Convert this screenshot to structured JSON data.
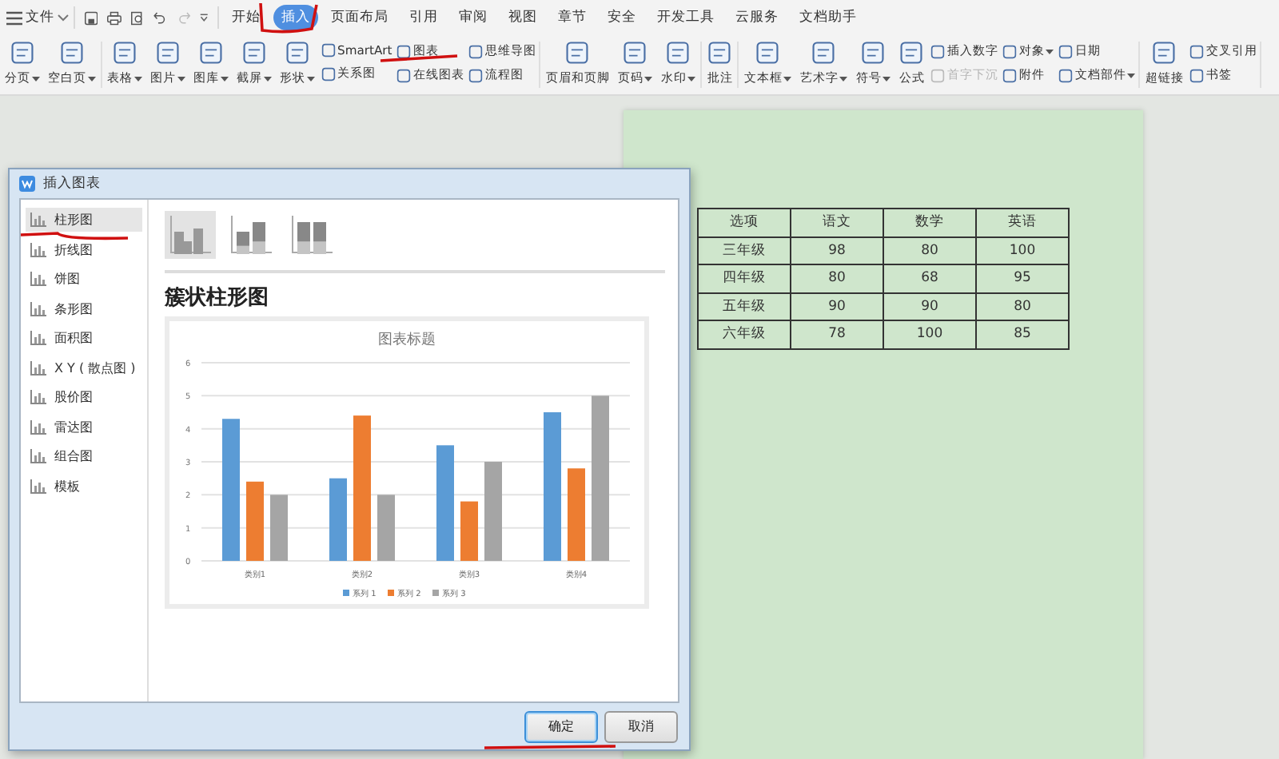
{
  "menu": {
    "label": "文件"
  },
  "tabs": [
    {
      "label": "开始",
      "selected": false
    },
    {
      "label": "插入",
      "selected": true
    },
    {
      "label": "页面布局",
      "selected": false
    },
    {
      "label": "引用",
      "selected": false
    },
    {
      "label": "审阅",
      "selected": false
    },
    {
      "label": "视图",
      "selected": false
    },
    {
      "label": "章节",
      "selected": false
    },
    {
      "label": "安全",
      "selected": false
    },
    {
      "label": "开发工具",
      "selected": false
    },
    {
      "label": "云服务",
      "selected": false
    },
    {
      "label": "文档助手",
      "selected": false
    }
  ],
  "ribbon": {
    "groups": [
      {
        "entries": [
          {
            "kind": "large",
            "label": "分页",
            "dropdown": true
          },
          {
            "kind": "large",
            "label": "空白页",
            "dropdown": true
          }
        ]
      },
      {
        "entries": [
          {
            "kind": "large",
            "label": "表格",
            "dropdown": true
          },
          {
            "kind": "large",
            "label": "图片",
            "dropdown": true
          },
          {
            "kind": "large",
            "label": "图库",
            "dropdown": true
          },
          {
            "kind": "large",
            "label": "截屏",
            "dropdown": true
          },
          {
            "kind": "large",
            "label": "形状",
            "dropdown": true
          },
          {
            "kind": "stack",
            "items": [
              {
                "label": "SmartArt",
                "dropdown": false,
                "disabled": false
              },
              {
                "label": "关系图",
                "dropdown": false,
                "disabled": false
              }
            ]
          },
          {
            "kind": "stack",
            "items": [
              {
                "label": "图表",
                "dropdown": false,
                "disabled": false
              },
              {
                "label": "在线图表",
                "dropdown": false,
                "disabled": false
              }
            ]
          },
          {
            "kind": "stack",
            "items": [
              {
                "label": "思维导图",
                "dropdown": false,
                "disabled": false
              },
              {
                "label": "流程图",
                "dropdown": false,
                "disabled": false
              }
            ]
          }
        ]
      },
      {
        "entries": [
          {
            "kind": "large",
            "label": "页眉和页脚",
            "dropdown": false
          },
          {
            "kind": "large",
            "label": "页码",
            "dropdown": true
          },
          {
            "kind": "large",
            "label": "水印",
            "dropdown": true
          }
        ]
      },
      {
        "entries": [
          {
            "kind": "large",
            "label": "批注",
            "dropdown": false
          }
        ]
      },
      {
        "entries": [
          {
            "kind": "large",
            "label": "文本框",
            "dropdown": true
          },
          {
            "kind": "large",
            "label": "艺术字",
            "dropdown": true
          },
          {
            "kind": "large",
            "label": "符号",
            "dropdown": true
          },
          {
            "kind": "large",
            "label": "公式",
            "dropdown": false
          },
          {
            "kind": "stack",
            "items": [
              {
                "label": "插入数字",
                "dropdown": false,
                "disabled": false
              },
              {
                "label": "首字下沉",
                "dropdown": false,
                "disabled": true
              }
            ]
          },
          {
            "kind": "stack",
            "items": [
              {
                "label": "对象",
                "dropdown": true,
                "disabled": false
              },
              {
                "label": "附件",
                "dropdown": false,
                "disabled": false
              }
            ]
          },
          {
            "kind": "stack",
            "items": [
              {
                "label": "日期",
                "dropdown": false,
                "disabled": false
              },
              {
                "label": "文档部件",
                "dropdown": true,
                "disabled": false
              }
            ]
          }
        ]
      },
      {
        "entries": [
          {
            "kind": "large",
            "label": "超链接",
            "dropdown": false
          },
          {
            "kind": "stack",
            "items": [
              {
                "label": "交叉引用",
                "dropdown": false,
                "disabled": false
              },
              {
                "label": "书签",
                "dropdown": false,
                "disabled": false
              }
            ]
          }
        ]
      }
    ]
  },
  "document": {
    "table": {
      "columns": [
        "选项",
        "语文",
        "数学",
        "英语"
      ],
      "rows": [
        [
          "三年级",
          "98",
          "80",
          "100"
        ],
        [
          "四年级",
          "80",
          "68",
          "95"
        ],
        [
          "五年级",
          "90",
          "90",
          "80"
        ],
        [
          "六年级",
          "78",
          "100",
          "85"
        ]
      ]
    }
  },
  "dialog": {
    "title": "插入图表",
    "types": [
      {
        "label": "柱形图",
        "selected": true
      },
      {
        "label": "折线图",
        "selected": false
      },
      {
        "label": "饼图",
        "selected": false
      },
      {
        "label": "条形图",
        "selected": false
      },
      {
        "label": "面积图",
        "selected": false
      },
      {
        "label": "X Y ( 散点图 )",
        "selected": false
      },
      {
        "label": "股价图",
        "selected": false
      },
      {
        "label": "雷达图",
        "selected": false
      },
      {
        "label": "组合图",
        "selected": false
      },
      {
        "label": "模板",
        "selected": false
      }
    ],
    "subtypes": [
      {
        "kind": "clustered",
        "selected": true
      },
      {
        "kind": "stacked",
        "selected": false
      },
      {
        "kind": "percent",
        "selected": false
      }
    ],
    "subtype_title": "簇状柱形图",
    "preview": {
      "chart_data": {
        "type": "bar",
        "title": "图表标题",
        "categories": [
          "类别1",
          "类别2",
          "类别3",
          "类别4"
        ],
        "series": [
          {
            "name": "系列 1",
            "color": "#5b9bd5",
            "values": [
              4.3,
              2.5,
              3.5,
              4.5
            ]
          },
          {
            "name": "系列 2",
            "color": "#ed7d31",
            "values": [
              2.4,
              4.4,
              1.8,
              2.8
            ]
          },
          {
            "name": "系列 3",
            "color": "#a5a5a5",
            "values": [
              2,
              2,
              3,
              5
            ]
          }
        ],
        "ylim": [
          0,
          6
        ],
        "yticks": [
          0,
          1,
          2,
          3,
          4,
          5,
          6
        ],
        "grid": true,
        "legend": true
      }
    },
    "buttons": [
      {
        "label": "确定",
        "default": true
      },
      {
        "label": "取消",
        "default": false
      }
    ]
  }
}
